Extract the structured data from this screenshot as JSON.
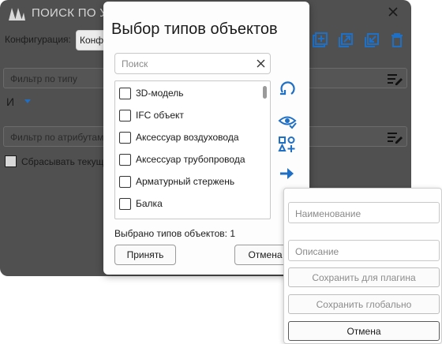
{
  "colors": {
    "accent": "#1f6fc5",
    "background_window": "#505050",
    "dialog": "#fdfdfd"
  },
  "background_window": {
    "title": "ПОИСК ПО У",
    "config_label": "Конфигурация:",
    "config_value": "Конфи",
    "type_filter_placeholder": "Фильтр по типу",
    "logic_operator": "И",
    "attribute_filter_placeholder": "Фильтр по атрибутам",
    "reset_checkbox_label": "Сбрасывать текущ",
    "icons": [
      "logo-icon",
      "close-icon",
      "add-icon",
      "export-icon",
      "import-icon",
      "delete-icon",
      "filter-edit-icon"
    ]
  },
  "dialog": {
    "title": "Выбор типов объектов",
    "search": {
      "placeholder": "Поиск",
      "value": ""
    },
    "items": [
      {
        "label": "3D-модель",
        "checked": false
      },
      {
        "label": "IFC объект",
        "checked": false
      },
      {
        "label": "Аксессуар воздуховода",
        "checked": false
      },
      {
        "label": "Аксессуар трубопровода",
        "checked": false
      },
      {
        "label": "Арматурный стержень",
        "checked": false
      },
      {
        "label": "Балка",
        "checked": false
      }
    ],
    "status_text": "Выбрано типов объектов: 1",
    "accept_label": "Принять",
    "cancel_label": "Отмена",
    "side_icons": [
      "rotate-icon",
      "view-icon",
      "shapes-add-icon",
      "arrow-right-icon"
    ]
  },
  "popup": {
    "name_placeholder": "Наименование",
    "description_placeholder": "Описание",
    "save_plugin_label": "Сохранить для плагина",
    "save_global_label": "Сохранить глобально",
    "cancel_label": "Отмена"
  }
}
